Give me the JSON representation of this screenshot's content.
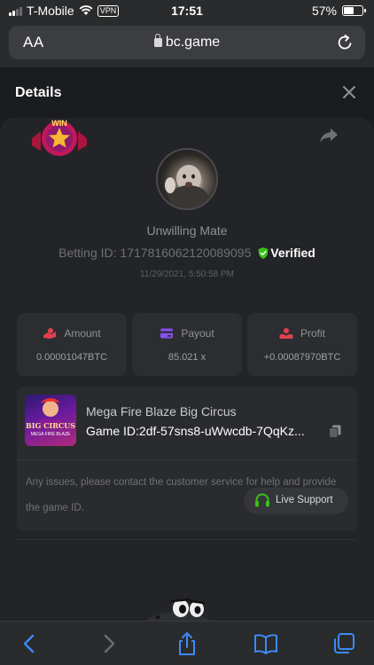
{
  "status_bar": {
    "carrier": "T-Mobile",
    "vpn": "VPN",
    "time": "17:51",
    "battery": "57%",
    "battery_level": 0.57
  },
  "browser": {
    "text_size": "AA",
    "url": "bc.game"
  },
  "details": {
    "title": "Details",
    "badge": "WIN",
    "username": "Unwilling Mate",
    "betting_id_label": "Betting ID:",
    "betting_id": "1717816062120089095",
    "verified": "Verified",
    "date": "11/29/2021, 5:50:58 PM"
  },
  "stats": [
    {
      "label": "Amount",
      "value": "0.00001047BTC",
      "icon": "amount-icon"
    },
    {
      "label": "Payout",
      "value": "85.021 x",
      "icon": "card-icon"
    },
    {
      "label": "Profit",
      "value": "+0.00087970BTC",
      "icon": "profit-icon"
    }
  ],
  "game": {
    "thumb_title": "BIG CIRCUS",
    "thumb_subtitle": "MEGA FIRE BLAZE",
    "name": "Mega Fire Blaze Big Circus",
    "id_label": "Game ID:",
    "id": "2df-57sns8-uWwcdb-7QqKz...",
    "issue_text": "Any issues, please contact the customer service for help and provide the game ID.",
    "live_support": "Live Support"
  },
  "colors": {
    "accent_green": "#3bc117",
    "background": "#1b1c1f",
    "card": "#232427"
  }
}
